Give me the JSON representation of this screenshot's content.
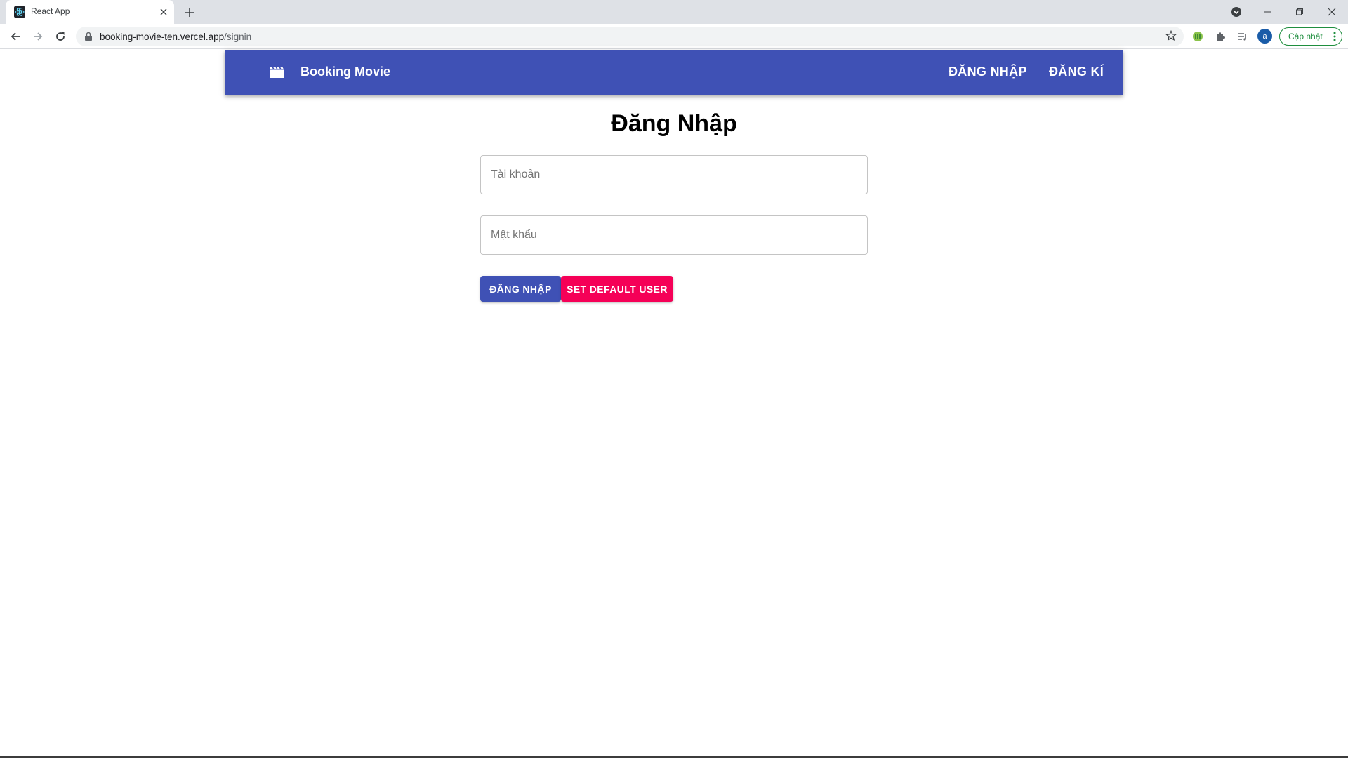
{
  "browser": {
    "tab_title": "React App",
    "url_host": "booking-movie-ten.vercel.app",
    "url_path": "/signin",
    "profile_initial": "a",
    "update_label": "Cập nhật"
  },
  "icons": {
    "favicon": "react-logo-icon",
    "tab_close": "close-icon",
    "new_tab": "plus-icon",
    "back": "arrow-left-icon",
    "forward": "arrow-right-icon",
    "reload": "reload-icon",
    "lock": "lock-icon",
    "bookmark": "star-icon",
    "brand": "movie-clapper-icon"
  },
  "appbar": {
    "brand": "Booking Movie",
    "nav": {
      "signin": "ĐĂNG NHẬP",
      "signup": "ĐĂNG KÍ"
    },
    "color": "#3f51b5"
  },
  "form": {
    "title": "Đăng Nhập",
    "username": {
      "placeholder": "Tài khoản",
      "value": ""
    },
    "password": {
      "placeholder": "Mật khẩu",
      "value": ""
    },
    "submit_label": "ĐĂNG NHẬP",
    "default_user_label": "SET DEFAULT USER",
    "primary_color": "#3f51b5",
    "secondary_color": "#f50057"
  }
}
